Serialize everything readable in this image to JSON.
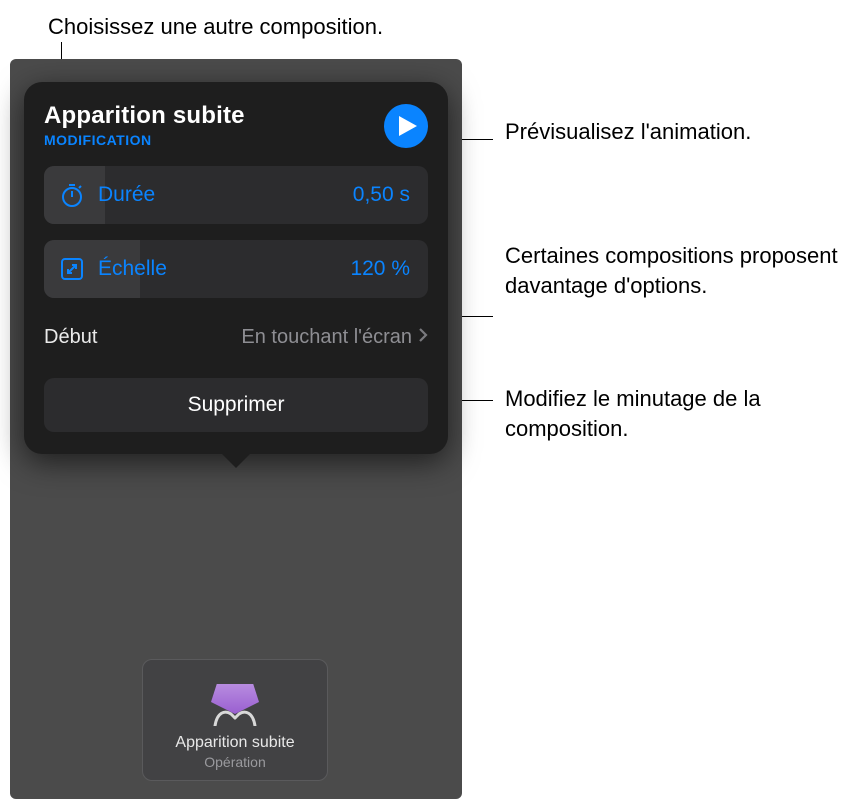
{
  "callouts": {
    "top": "Choisissez une autre composition.",
    "preview": "Prévisualisez l'animation.",
    "options": "Certaines compositions proposent davantage d'options.",
    "timing": "Modifiez le minutage de la composition."
  },
  "popover": {
    "title": "Apparition subite",
    "subtitle": "MODIFICATION",
    "duration": {
      "label": "Durée",
      "value": "0,50 s"
    },
    "scale": {
      "label": "Échelle",
      "value": "120 %"
    },
    "start": {
      "label": "Début",
      "value": "En touchant l'écran"
    },
    "delete_label": "Supprimer"
  },
  "thumbnail": {
    "title": "Apparition subite",
    "subtitle": "Opération"
  }
}
